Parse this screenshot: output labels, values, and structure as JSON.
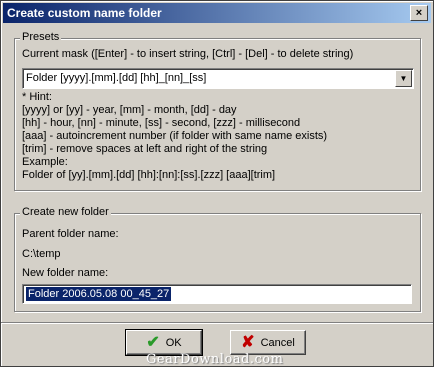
{
  "window": {
    "title": "Create custom name folder",
    "close_glyph": "×"
  },
  "presets": {
    "legend": "Presets",
    "mask_label": "Current mask  ([Enter] - to insert string, [Ctrl] - [Del] - to delete string)",
    "mask_value": "Folder [yyyy].[mm].[dd] [hh]_[nn]_[ss]",
    "hint_lines": [
      "* Hint:",
      "[yyyy] or [yy] - year, [mm] - month, [dd] - day",
      "[hh] - hour, [nn] - minute, [ss] - second, [zzz] - millisecond",
      "[aaa] - autoincrement number (if folder with same name exists)",
      "[trim] - remove spaces at left and right of the string",
      "Example:",
      "Folder of [yy].[mm].[dd] [hh]:[nn]:[ss].[zzz] [aaa][trim]"
    ]
  },
  "create": {
    "legend": "Create new folder",
    "parent_label": "Parent folder name:",
    "parent_value": "C:\\temp",
    "new_label": "New folder name:",
    "new_value": "Folder 2006.05.08 00_45_27"
  },
  "buttons": {
    "ok_label": "OK",
    "cancel_label": "Cancel"
  },
  "icons": {
    "ok": "check-icon",
    "cancel": "x-icon",
    "dropdown": "triangle-down-icon"
  },
  "watermark": "GearDownload.com"
}
